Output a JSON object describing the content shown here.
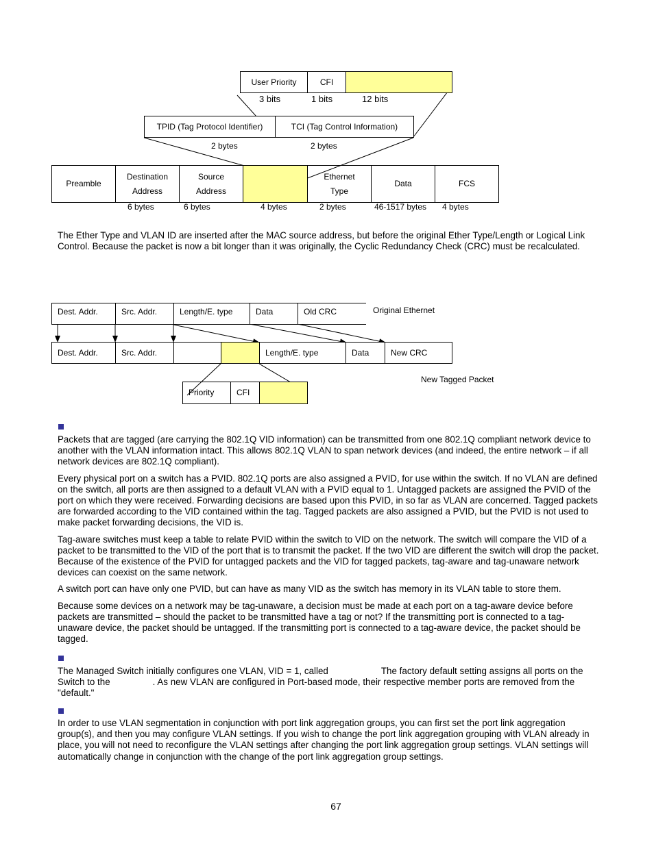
{
  "diagram1": {
    "tci_fields": [
      "User Priority",
      "CFI",
      ""
    ],
    "tci_sizes": [
      "3 bits",
      "1 bits",
      "12 bits"
    ],
    "tag_fields": [
      "TPID (Tag Protocol Identifier)",
      "TCI (Tag Control Information)"
    ],
    "tag_sizes": [
      "2 bytes",
      "2 bytes"
    ],
    "frame_fields": [
      {
        "line1": "Preamble",
        "line2": ""
      },
      {
        "line1": "Destination",
        "line2": "Address"
      },
      {
        "line1": "Source",
        "line2": "Address"
      },
      {
        "line1": "",
        "line2": ""
      },
      {
        "line1": "Ethernet",
        "line2": "Type"
      },
      {
        "line1": "Data",
        "line2": ""
      },
      {
        "line1": "FCS",
        "line2": ""
      }
    ],
    "frame_sizes": [
      "6 bytes",
      "6 bytes",
      "4 bytes",
      "2 bytes",
      "46-1517 bytes",
      "4 bytes"
    ],
    "highlight_color": "#ffff99"
  },
  "para_insert": "The Ether Type and VLAN ID are inserted after the MAC source address, but before the original Ether Type/Length or Logical Link Control. Because the packet is now a bit longer than it was originally, the Cyclic Redundancy Check (CRC) must be recalculated.",
  "diagram2": {
    "original_fields": [
      "Dest. Addr.",
      "Src. Addr.",
      "Length/E. type",
      "Data",
      "Old CRC"
    ],
    "original_label": "Original Ethernet",
    "tagged_fields": [
      "Dest. Addr.",
      "Src. Addr.",
      "",
      "",
      "Length/E. type",
      "Data",
      "New CRC"
    ],
    "tagged_label": "New Tagged Packet",
    "tag_detail_fields": [
      "Priority",
      "CFI",
      ""
    ]
  },
  "section1": {
    "paragraphs": [
      "Packets that are tagged (are carrying the 802.1Q VID information) can be transmitted from one 802.1Q compliant network device to another with the VLAN information intact. This allows 802.1Q VLAN to span network devices (and indeed, the entire network – if all network devices are 802.1Q compliant).",
      "Every physical port on a switch has a PVID. 802.1Q ports are also assigned a PVID, for use within the switch. If no VLAN are defined on the switch, all ports are then assigned to a default VLAN with a PVID equal to 1. Untagged packets are assigned the PVID of the port on which they were received. Forwarding decisions are based upon this PVID, in so far as VLAN are concerned. Tagged packets are forwarded according to the VID contained within the tag. Tagged packets are also assigned a PVID, but the PVID is not used to make packet forwarding decisions, the VID is.",
      "Tag-aware switches must keep a table to relate PVID within the switch to VID on the network. The switch will compare the VID of a packet to be transmitted to the VID of the port that is to transmit the packet. If the two VID are different the switch will drop the packet. Because of the existence of the PVID for untagged packets and the VID for tagged packets, tag-aware and tag-unaware network devices can coexist on the same network.",
      "A switch port can have only one PVID, but can have as many VID as the switch has memory in its VLAN table to store them.",
      "Because some devices on a network may be tag-unaware, a decision must be made at each port on a tag-aware device before packets are transmitted – should the packet to be transmitted have a tag or not? If the transmitting port is connected to a tag-unaware device, the packet should be untagged. If the transmitting port is connected to a tag-aware device, the packet should be tagged."
    ]
  },
  "section2": {
    "part1": "The Managed Switch initially configures one VLAN, VID = 1, called",
    "part2": "The factory default setting assigns all ports on the Switch to the",
    "part3": ". As new VLAN are configured in Port-based mode, their respective member ports are removed from the \"default.\""
  },
  "section3": {
    "paragraph": "In order to use VLAN segmentation in conjunction with port link aggregation groups, you can first set the port link aggregation group(s), and then you may configure VLAN settings. If you wish to change the port link aggregation grouping with VLAN already in place, you will not need to reconfigure the VLAN settings after changing the port link aggregation group settings. VLAN settings will automatically change in conjunction with the change of the port link aggregation group settings."
  },
  "bullet_color": "#333399",
  "page_number": "67"
}
